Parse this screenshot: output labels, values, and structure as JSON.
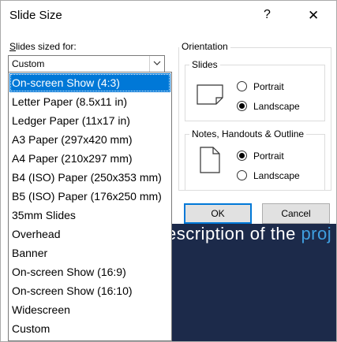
{
  "dialog": {
    "title": "Slide Size",
    "help": "?",
    "close": "✕"
  },
  "slides_sized_for": {
    "label_accel": "S",
    "label_rest": "lides sized for:",
    "value": "Custom"
  },
  "dropdown": {
    "items": [
      "On-screen Show (4:3)",
      "Letter Paper (8.5x11 in)",
      "Ledger Paper (11x17 in)",
      "A3 Paper (297x420 mm)",
      "A4 Paper (210x297 mm)",
      "B4 (ISO) Paper (250x353 mm)",
      "B5 (ISO) Paper (176x250 mm)",
      "35mm Slides",
      "Overhead",
      "Banner",
      "On-screen Show (16:9)",
      "On-screen Show (16:10)",
      "Widescreen",
      "Custom"
    ],
    "selected": "On-screen Show (4:3)"
  },
  "orientation": {
    "title": "Orientation",
    "slides": {
      "title": "Slides",
      "portrait": "Portrait",
      "landscape": "Landscape",
      "selected": "Landscape"
    },
    "notes": {
      "title": "Notes, Handouts & Outline",
      "portrait": "Portrait",
      "landscape": "Landscape",
      "selected": "Portrait"
    }
  },
  "buttons": {
    "ok": "OK",
    "cancel": "Cancel"
  },
  "background": {
    "text": "escription of the ",
    "link": "proj"
  },
  "colors": {
    "accent": "#0078d7",
    "slide_bg": "#1c2a4a"
  }
}
